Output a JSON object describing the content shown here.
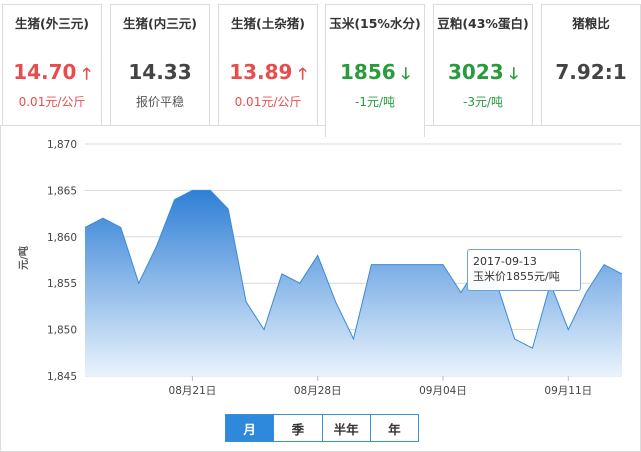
{
  "cards": [
    {
      "title": "生猪(外三元)",
      "value": "14.70",
      "arrow": "🡑",
      "change": "0.01元/公斤",
      "trend": "up"
    },
    {
      "title": "生猪(内三元)",
      "value": "14.33",
      "arrow": "",
      "change": "报价平稳",
      "trend": "flat"
    },
    {
      "title": "生猪(土杂猪)",
      "value": "13.89",
      "arrow": "🡑",
      "change": "0.01元/公斤",
      "trend": "up"
    },
    {
      "title": "玉米(15%水分)",
      "value": "1856",
      "arrow": "🡓",
      "change": "-1元/吨",
      "trend": "down"
    },
    {
      "title": "豆粕(43%蛋白)",
      "value": "3023",
      "arrow": "🡓",
      "change": "-3元/吨",
      "trend": "down"
    },
    {
      "title": "猪粮比",
      "value": "7.92:1",
      "arrow": "",
      "change": "",
      "trend": "flat"
    }
  ],
  "colors": {
    "up": "#e94c4c",
    "down": "#2a9b3c",
    "accent": "#2e88dc",
    "area_top": "#2f7fd6",
    "area_bottom": "#eaf3fc",
    "line": "#3a8ad6"
  },
  "chart_data": {
    "type": "area",
    "ylabel": "元/吨",
    "ylim": [
      1845,
      1870
    ],
    "yticks": [
      "1,845",
      "1,850",
      "1,855",
      "1,860",
      "1,865",
      "1,870"
    ],
    "xticks": [
      "08月21日",
      "08月28日",
      "09月04日",
      "09月11日"
    ],
    "x": [
      "08-15",
      "08-16",
      "08-17",
      "08-18",
      "08-19",
      "08-20",
      "08-21",
      "08-22",
      "08-23",
      "08-24",
      "08-25",
      "08-26",
      "08-27",
      "08-28",
      "08-29",
      "08-30",
      "08-31",
      "09-01",
      "09-02",
      "09-03",
      "09-04",
      "09-05",
      "09-06",
      "09-07",
      "09-08",
      "09-09",
      "09-10",
      "09-11",
      "09-12",
      "09-13",
      "09-14"
    ],
    "values": [
      1861,
      1862,
      1861,
      1855,
      1859,
      1864,
      1865,
      1865,
      1863,
      1853,
      1850,
      1856,
      1855,
      1858,
      1853,
      1849,
      1857,
      1857,
      1857,
      1857,
      1857,
      1854,
      1857,
      1855,
      1849,
      1848,
      1855,
      1850,
      1854,
      1857,
      1856
    ],
    "grid": true,
    "tooltip": {
      "date": "2017-09-13",
      "text": "玉米价1855元/吨"
    }
  },
  "range_tabs": [
    {
      "label": "月",
      "selected": true
    },
    {
      "label": "季",
      "selected": false
    },
    {
      "label": "半年",
      "selected": false
    },
    {
      "label": "年",
      "selected": false
    }
  ]
}
